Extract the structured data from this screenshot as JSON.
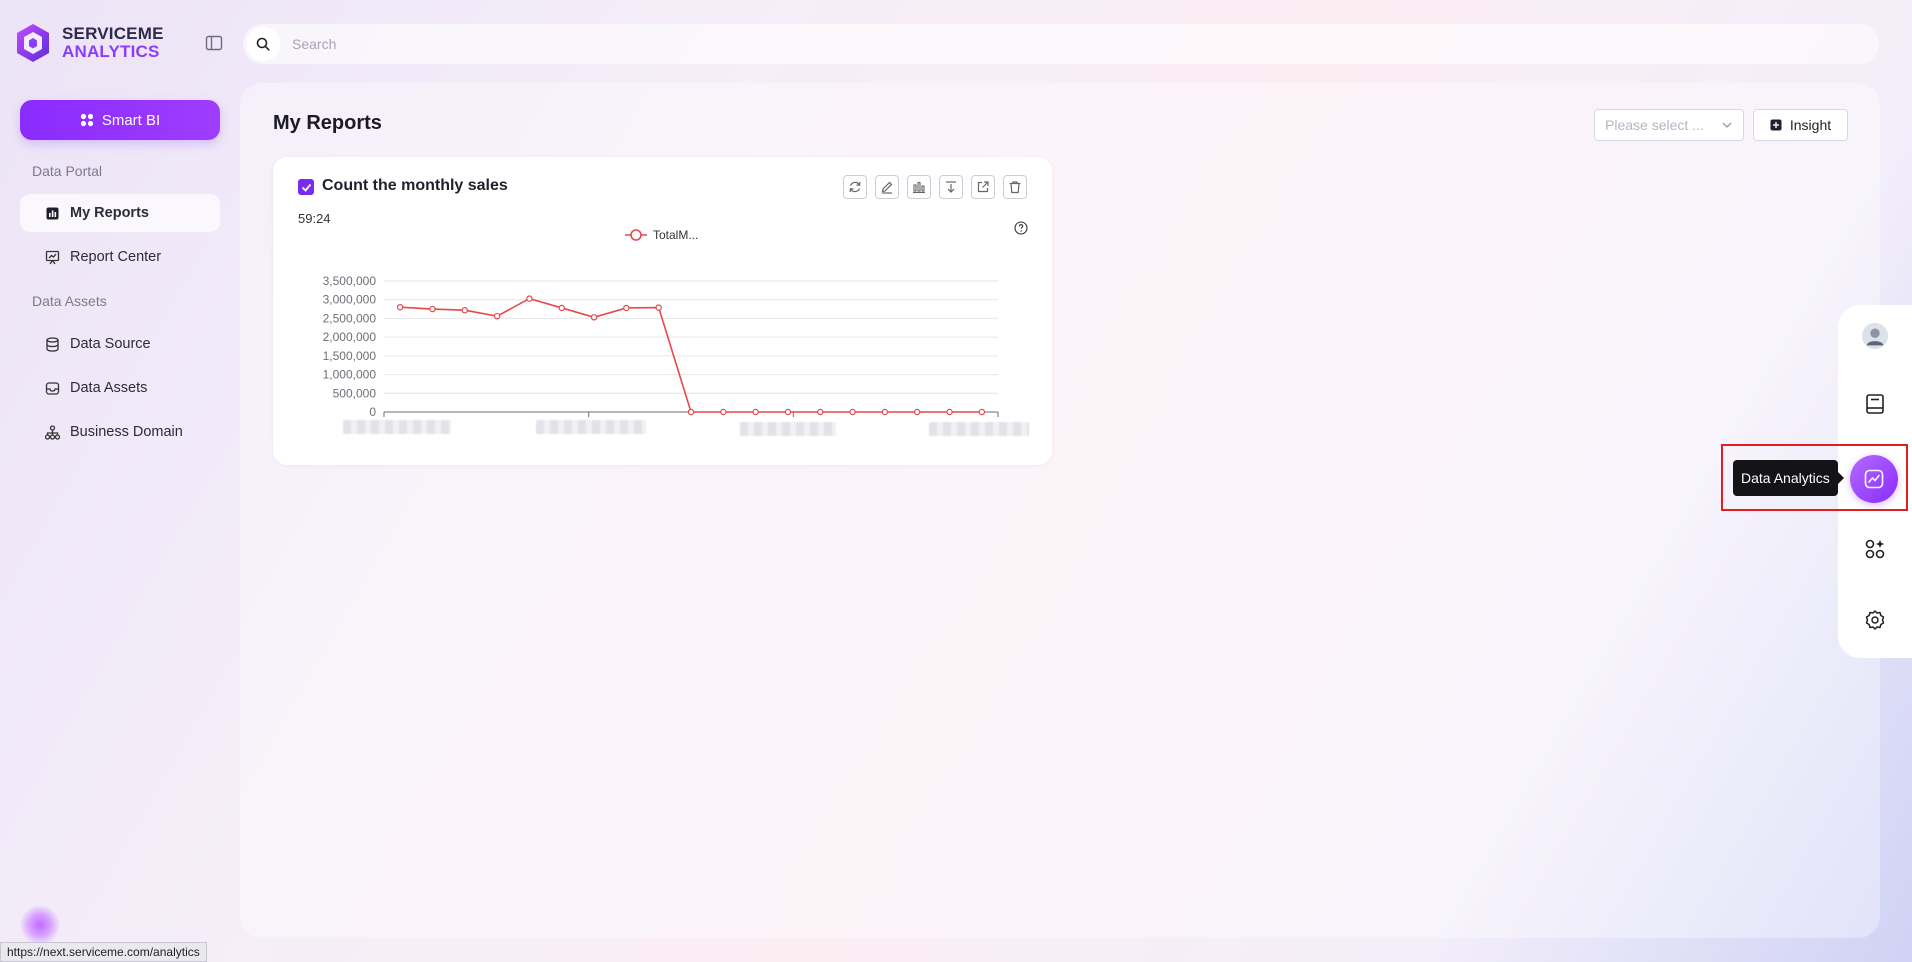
{
  "brand": {
    "line1": "SERVICEME",
    "line2": "ANALYTICS"
  },
  "search": {
    "placeholder": "Search"
  },
  "sidebar": {
    "primary_button": "Smart BI",
    "sections": [
      {
        "label": "Data Portal"
      },
      {
        "label": "Data Assets"
      }
    ],
    "items": [
      {
        "label": "My Reports",
        "icon": "bar-chart-icon",
        "active": true
      },
      {
        "label": "Report Center",
        "icon": "presentation-icon"
      },
      {
        "label": "Data Source",
        "icon": "database-icon"
      },
      {
        "label": "Data Assets",
        "icon": "inbox-icon"
      },
      {
        "label": "Business Domain",
        "icon": "hierarchy-icon"
      }
    ]
  },
  "main": {
    "title": "My Reports",
    "select_placeholder": "Please select ...",
    "insight_label": "Insight"
  },
  "report": {
    "title": "Count the monthly sales",
    "time": "59:24",
    "checked": true,
    "tools": [
      "refresh-icon",
      "edit-icon",
      "chart-type-icon",
      "download-icon",
      "share-icon",
      "delete-icon"
    ]
  },
  "chart_data": {
    "type": "line",
    "legend": [
      "TotalM..."
    ],
    "legend_position": "top-center",
    "ylim": [
      0,
      3500000
    ],
    "yticks": [
      "0",
      "500,000",
      "1,000,000",
      "1,500,000",
      "2,000,000",
      "2,500,000",
      "3,000,000",
      "3,500,000"
    ],
    "grid": true,
    "series": [
      {
        "name": "TotalM...",
        "color": "#e8474b",
        "values": [
          2800000,
          2750000,
          2720000,
          2560000,
          3030000,
          2780000,
          2530000,
          2780000,
          2790000,
          0,
          0,
          0,
          0,
          0,
          0,
          0,
          0,
          0,
          0
        ]
      }
    ]
  },
  "right_rail": {
    "items": [
      "avatar-icon",
      "book-icon",
      "data-analytics-icon",
      "apps-icon",
      "gear-icon"
    ],
    "active": "data-analytics-icon",
    "tooltip": "Data Analytics"
  },
  "status_bar": {
    "url": "https://next.serviceme.com/analytics"
  }
}
